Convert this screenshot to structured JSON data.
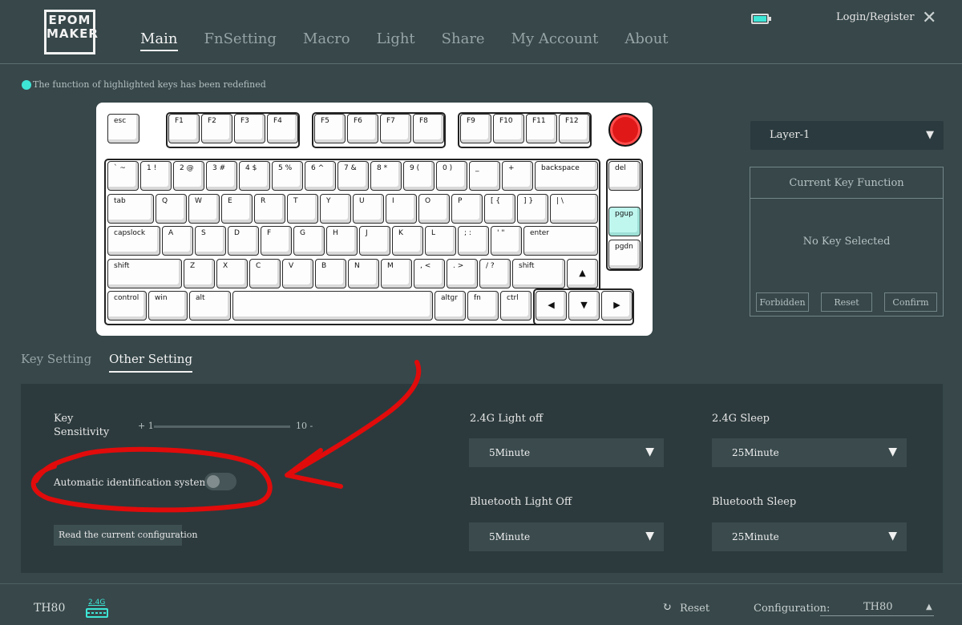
{
  "header": {
    "logo": {
      "line1": "EPOM",
      "line2": "MAKER"
    },
    "nav": [
      "Main",
      "FnSetting",
      "Macro",
      "Light",
      "Share",
      "My Account",
      "About"
    ],
    "active_nav": "Main",
    "login": "Login/Register"
  },
  "hint": "The function of highlighted keys has been redefined",
  "keyboard": {
    "fn_row": [
      "esc",
      "F1",
      "F2",
      "F3",
      "F4",
      "F5",
      "F6",
      "F7",
      "F8",
      "F9",
      "F10",
      "F11",
      "F12"
    ],
    "row1": [
      "` ~",
      "1 !",
      "2 @",
      "3 #",
      "4 $",
      "5 %",
      "6 ^",
      "7 &",
      "8 *",
      "9 (",
      "0 )",
      "_",
      "+",
      "backspace"
    ],
    "row2": [
      "tab",
      "Q",
      "W",
      "E",
      "R",
      "T",
      "Y",
      "U",
      "I",
      "O",
      "P",
      "[ {",
      "] }",
      "| \\"
    ],
    "row3": [
      "capslock",
      "A",
      "S",
      "D",
      "F",
      "G",
      "H",
      "J",
      "K",
      "L",
      "; :",
      "' \"",
      "enter"
    ],
    "row4": [
      "shift",
      "Z",
      "X",
      "C",
      "V",
      "B",
      "N",
      "M",
      ", <",
      ". >",
      "/ ?",
      "shift"
    ],
    "row5": [
      "control",
      "win",
      "alt",
      "",
      "altgr",
      "fn",
      "ctrl"
    ],
    "nav_cluster": [
      "del",
      "pgup",
      "pgdn"
    ],
    "highlighted": [
      "pgup"
    ]
  },
  "layer_select": {
    "value": "Layer-1"
  },
  "current_key": {
    "title": "Current Key Function",
    "status": "No Key Selected",
    "buttons": [
      "Forbidden",
      "Reset",
      "Confirm"
    ]
  },
  "tabs": [
    "Key Setting",
    "Other Setting"
  ],
  "active_tab": "Other Setting",
  "settings": {
    "sensitivity_label_1": "Key",
    "sensitivity_label_2": "Sensitivity",
    "sensitivity_min": "+ 1",
    "sensitivity_max": "10 -",
    "auto_id_label": "Automatic identification system",
    "auto_id_on": false,
    "read_config": "Read the current configuration",
    "light_off_24": {
      "label": "2.4G Light off",
      "value": "5Minute"
    },
    "sleep_24": {
      "label": "2.4G Sleep",
      "value": "25Minute"
    },
    "bt_light_off": {
      "label": "Bluetooth Light Off",
      "value": "5Minute"
    },
    "bt_sleep": {
      "label": "Bluetooth Sleep",
      "value": "25Minute"
    }
  },
  "footer": {
    "device": "TH80",
    "conn_badge": "2.4G",
    "reset": "Reset",
    "config_label": "Configuration:",
    "config_value": "TH80"
  },
  "colors": {
    "accent": "#3ee6d6",
    "annotation": "#e10b0b",
    "panel": "#2c3a3d",
    "background": "#37474a"
  }
}
